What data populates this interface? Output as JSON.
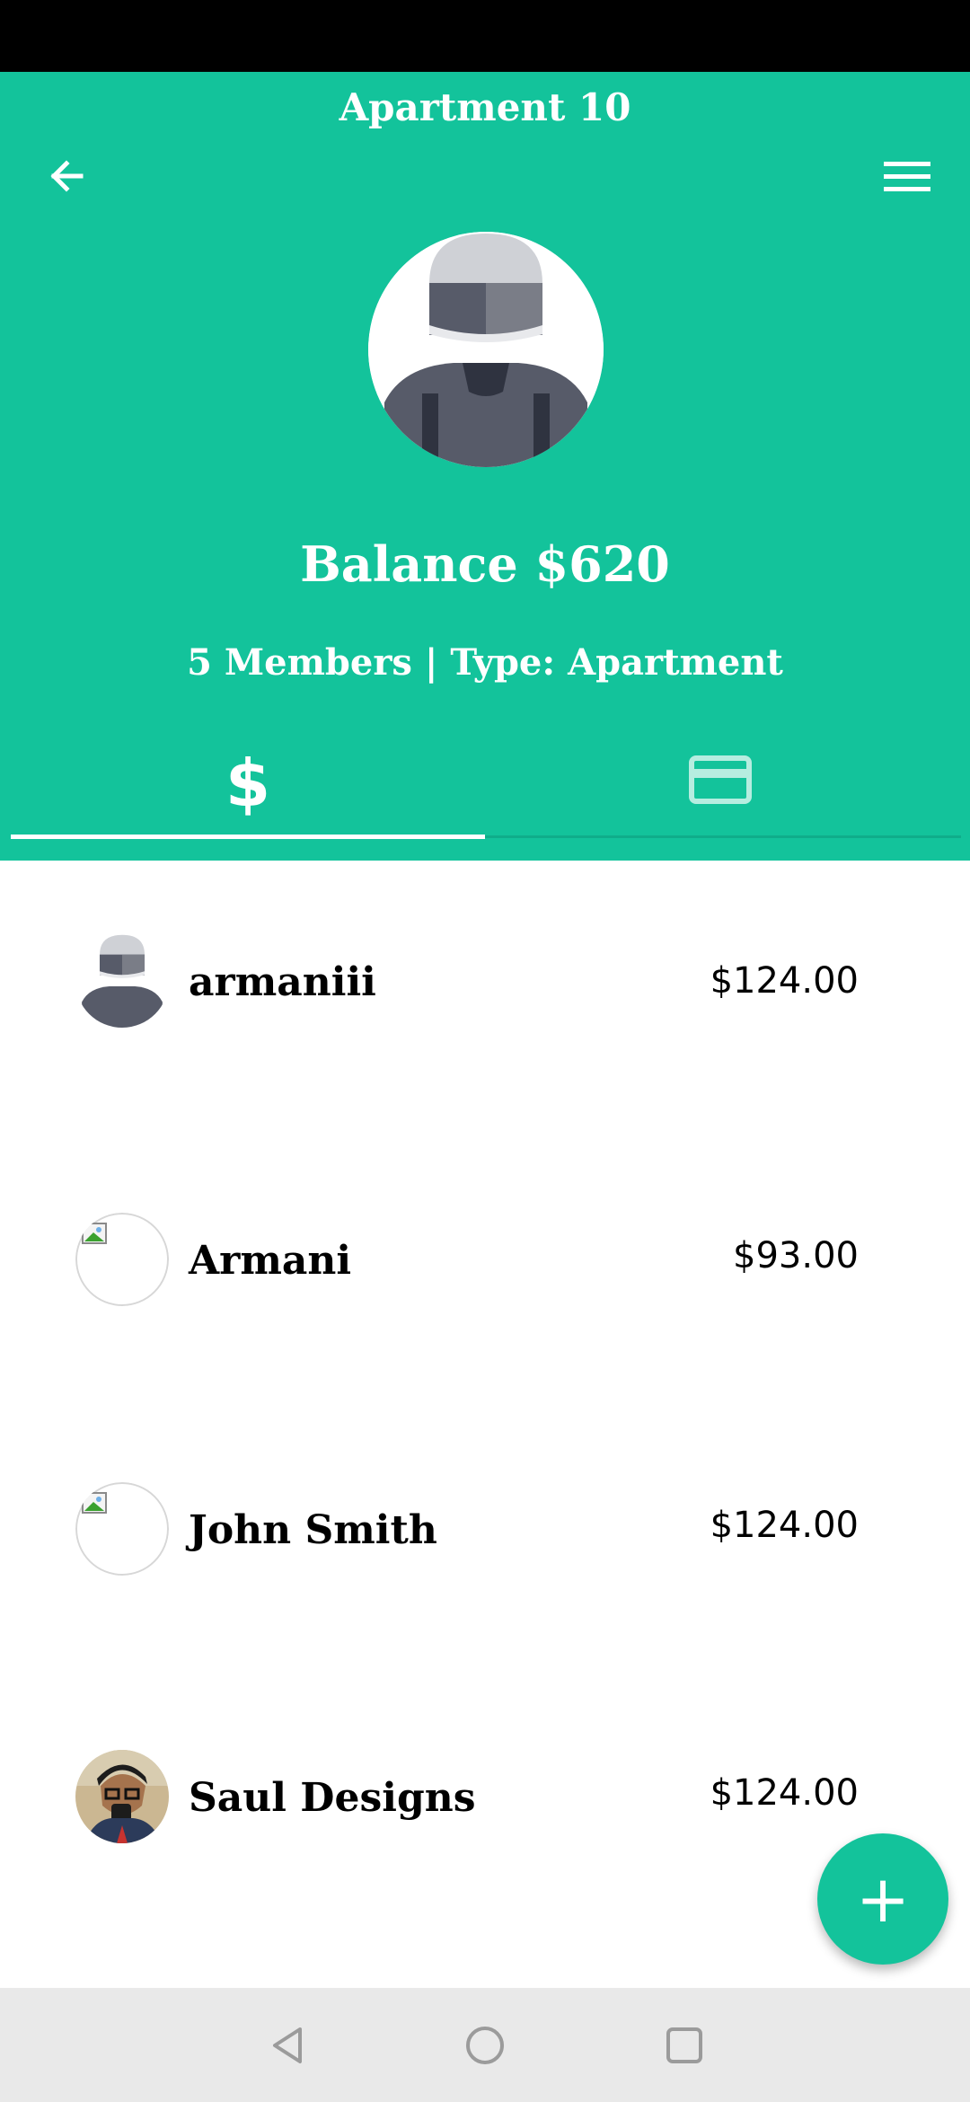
{
  "app": {
    "title": "Apartment 10",
    "balance_text": "Balance $620",
    "members_text": "5 Members | Type: Apartment",
    "accent_color": "#13c39b"
  },
  "icons": {
    "back": "arrow-left-icon",
    "menu": "hamburger-menu-icon",
    "tab_dollar": "$",
    "tab_card": "credit-card-icon",
    "fab": "+",
    "nav_back": "triangle-back-icon",
    "nav_home": "circle-home-icon",
    "nav_recents": "square-recents-icon"
  },
  "members": [
    {
      "name": "armaniii",
      "amount": "$124.00",
      "avatar": "helmet-avatar"
    },
    {
      "name": "Armani",
      "amount": "$93.00",
      "avatar": "broken-image"
    },
    {
      "name": "John Smith",
      "amount": "$124.00",
      "avatar": "broken-image"
    },
    {
      "name": "Saul Designs",
      "amount": "$124.00",
      "avatar": "photo-avatar"
    }
  ]
}
